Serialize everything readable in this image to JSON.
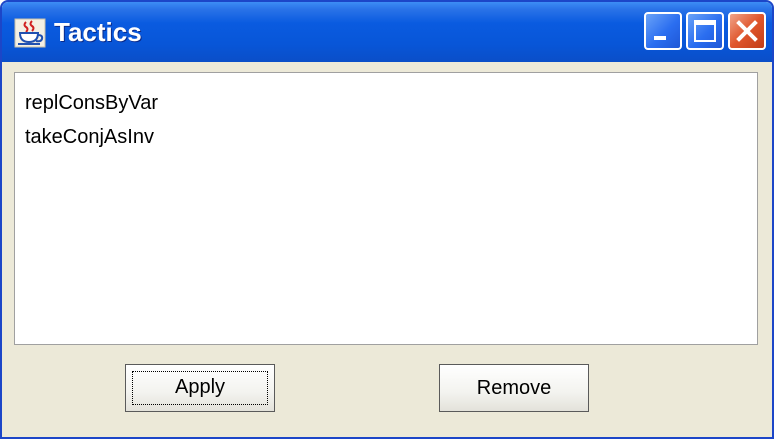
{
  "window": {
    "title": "Tactics",
    "app_icon": "java-cup-icon",
    "controls": {
      "minimize_icon": "minimize-icon",
      "maximize_icon": "maximize-icon",
      "close_icon": "close-icon"
    }
  },
  "tactics_list": {
    "items": [
      {
        "label": "replConsByVar"
      },
      {
        "label": "takeConjAsInv"
      }
    ]
  },
  "buttons": {
    "apply_label": "Apply",
    "remove_label": "Remove"
  },
  "colors": {
    "titlebar": "#0856d8",
    "window_bg": "#ece9d8",
    "close_button": "#e0562c"
  }
}
